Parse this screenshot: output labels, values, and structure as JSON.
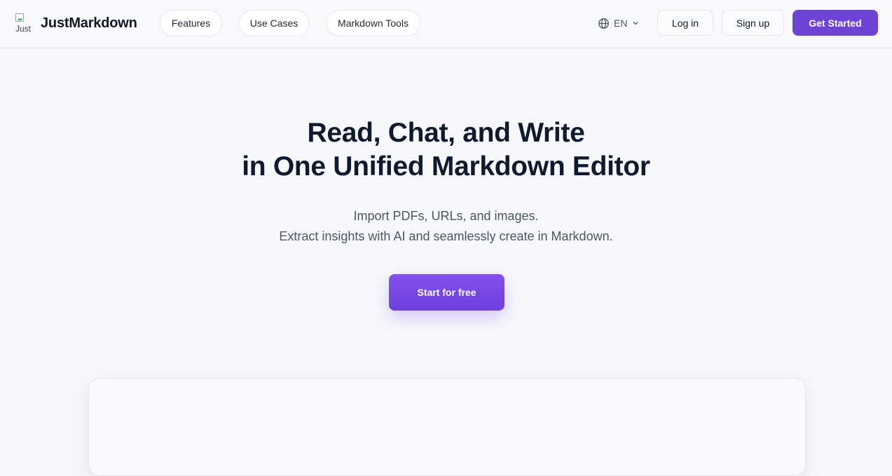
{
  "brand": {
    "name": "JustMarkdown",
    "logo_alt": "Just"
  },
  "nav": {
    "items": [
      "Features",
      "Use Cases",
      "Markdown Tools"
    ]
  },
  "language": {
    "label": "EN"
  },
  "auth": {
    "login": "Log in",
    "signup": "Sign up",
    "get_started": "Get Started"
  },
  "hero": {
    "title_line1": "Read, Chat, and Write",
    "title_line2": "in One Unified Markdown Editor",
    "sub_line1": "Import PDFs, URLs, and images.",
    "sub_line2": "Extract insights with AI and seamlessly create in Markdown.",
    "cta": "Start for free"
  },
  "colors": {
    "accent": "#6d44d6",
    "heading": "#0f1a2e",
    "background": "#f7f8fc"
  }
}
